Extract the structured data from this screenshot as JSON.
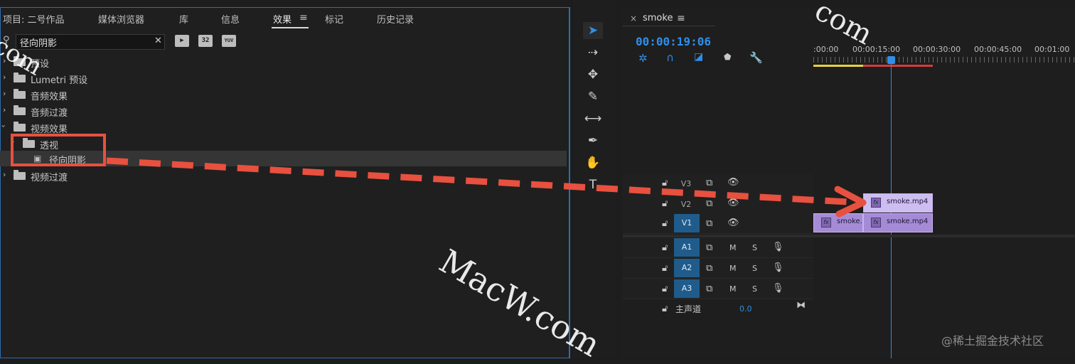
{
  "effects_panel": {
    "tabs": [
      {
        "label": "项目: 二号作品"
      },
      {
        "label": "媒体浏览器"
      },
      {
        "label": "库"
      },
      {
        "label": "信息"
      },
      {
        "label": "效果",
        "active": true
      },
      {
        "label": "标记"
      },
      {
        "label": "历史记录"
      }
    ],
    "menu_glyph": "≡",
    "search": {
      "value": "径向阴影",
      "clear": "✕"
    },
    "filter_buttons": [
      "accelerated",
      "32",
      "YUV"
    ],
    "tree": [
      {
        "label": "预设",
        "expanded": false,
        "indent": 0
      },
      {
        "label": "Lumetri 预设",
        "expanded": false,
        "indent": 0
      },
      {
        "label": "音频效果",
        "expanded": false,
        "indent": 0
      },
      {
        "label": "音频过渡",
        "expanded": false,
        "indent": 0
      },
      {
        "label": "视频效果",
        "expanded": true,
        "indent": 0
      },
      {
        "label": "透视",
        "expanded": true,
        "indent": 1
      },
      {
        "label": "径向阴影",
        "indent": 2,
        "selected": true
      },
      {
        "label": "视频过渡",
        "expanded": false,
        "indent": 0
      }
    ]
  },
  "timeline": {
    "sequence_name": "smoke",
    "close_glyph": "×",
    "menu_glyph": "≡",
    "timecode": "00:00:19:06",
    "ruler_labels": [
      ":00:00",
      "00:00:15:00",
      "00:00:30:00",
      "00:00:45:00",
      "00:01:00"
    ],
    "video_tracks": [
      {
        "name": "V3",
        "targeted": false
      },
      {
        "name": "V2",
        "targeted": false
      },
      {
        "name": "V1",
        "targeted": true
      }
    ],
    "audio_tracks": [
      {
        "name": "A1",
        "m": "M",
        "s": "S"
      },
      {
        "name": "A2",
        "m": "M",
        "s": "S"
      },
      {
        "name": "A3",
        "m": "M",
        "s": "S"
      }
    ],
    "master": {
      "label": "主声道",
      "value": "0.0"
    },
    "clips": [
      {
        "track": "V2",
        "name": "smoke.mp4",
        "fx": "fx"
      },
      {
        "track": "V1",
        "name": "smoke.",
        "fx": "fx"
      },
      {
        "track": "V1",
        "name": "smoke.mp4",
        "fx": "fx"
      }
    ]
  },
  "watermarks": {
    "macw": "MacW.com",
    "corner_com": "com",
    "left_com": "com",
    "credit": "@稀土掘金技术社区"
  },
  "colors": {
    "accent_blue": "#2f8ee8",
    "annotation_red": "#e8503f",
    "clip_purple": "#a58bd6",
    "track_target_blue": "#1f5c8c"
  }
}
